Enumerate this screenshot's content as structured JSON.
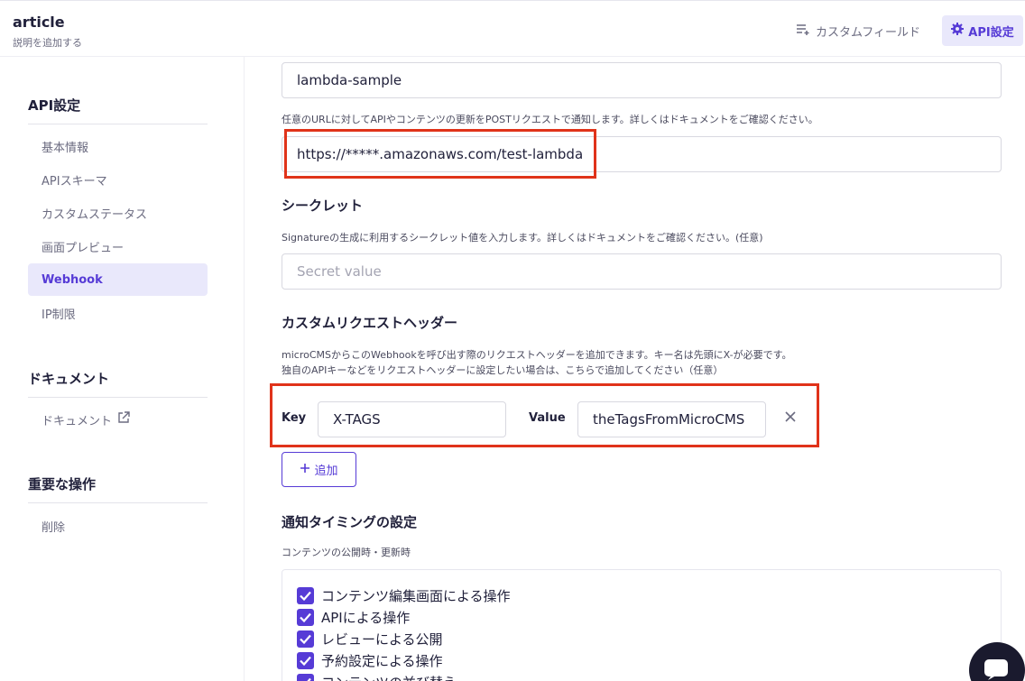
{
  "header": {
    "title": "article",
    "subtitle": "説明を追加する",
    "custom_field_label": "カスタムフィールド",
    "api_settings_label": "API設定"
  },
  "sidebar": {
    "api_section_title": "API設定",
    "items": [
      {
        "label": "基本情報"
      },
      {
        "label": "APIスキーマ"
      },
      {
        "label": "カスタムステータス"
      },
      {
        "label": "画面プレビュー"
      },
      {
        "label": "Webhook"
      },
      {
        "label": "IP制限"
      }
    ],
    "docs_section_title": "ドキュメント",
    "docs_item_label": "ドキュメント",
    "danger_section_title": "重要な操作",
    "delete_label": "削除"
  },
  "main": {
    "name_value": "lambda-sample",
    "url_description": "任意のURLに対してAPIやコンテンツの更新をPOSTリクエストで通知します。詳しくはドキュメントをご確認ください。",
    "url_value": "https://*****.amazonaws.com/test-lambda",
    "secret_title": "シークレット",
    "secret_description": "Signatureの生成に利用するシークレット値を入力します。詳しくはドキュメントをご確認ください。(任意)",
    "secret_placeholder": "Secret value",
    "headers_title": "カスタムリクエストヘッダー",
    "headers_description_1": "microCMSからこのWebhookを呼び出す際のリクエストヘッダーを追加できます。キー名は先頭にX-が必要です。",
    "headers_description_2": "独自のAPIキーなどをリクエストヘッダーに設定したい場合は、こちらで追加してください（任意）",
    "key_label": "Key",
    "key_value": "X-TAGS",
    "value_label": "Value",
    "value_value": "theTagsFromMicroCMS",
    "add_label": "追加",
    "timing_title": "通知タイミングの設定",
    "timing_subtitle": "コンテンツの公開時・更新時",
    "timing_options": [
      {
        "label": "コンテンツ編集画面による操作",
        "checked": true
      },
      {
        "label": "APIによる操作",
        "checked": true
      },
      {
        "label": "レビューによる公開",
        "checked": true
      },
      {
        "label": "予約設定による操作",
        "checked": true
      },
      {
        "label": "コンテンツの並び替え",
        "checked": true
      }
    ]
  },
  "colors": {
    "accent": "#563bd6",
    "highlight_border": "#e0331a",
    "active_bg": "#e9e8fb"
  }
}
